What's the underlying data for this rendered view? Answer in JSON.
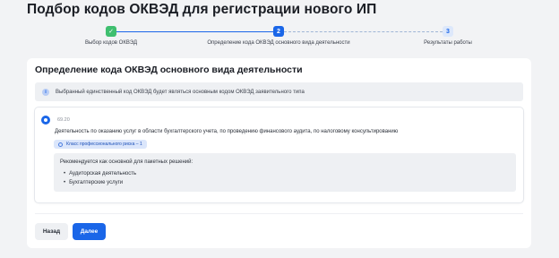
{
  "page": {
    "title": "Подбор кодов ОКВЭД для регистрации нового ИП"
  },
  "stepper": {
    "steps": [
      {
        "number": "✓",
        "label": "Выбор кодов ОКВЭД",
        "state": "done"
      },
      {
        "number": "2",
        "label": "Определение кода ОКВЭД основного вида деятельности",
        "state": "active"
      },
      {
        "number": "3",
        "label": "Результаты работы",
        "state": "todo"
      }
    ]
  },
  "card": {
    "title": "Определение кода ОКВЭД основного вида деятельности",
    "info": {
      "icon": "info-icon",
      "text": "Выбранный единственный код ОКВЭД будет являться основным кодом ОКВЭД заявительного типа"
    },
    "option": {
      "selected": true,
      "code": "69.20",
      "description": "Деятельность по оказанию услуг в области бухгалтерского учета, по проведению финансового аудита, по налоговому консультированию",
      "risk_badge": "Класс профессионального риска – 1",
      "recommendation": {
        "title": "Рекомендуется как основной для пакетных решений:",
        "items": [
          "Аудиторская деятельность",
          "Бухгалтерские услуги"
        ]
      }
    }
  },
  "buttons": {
    "back": "Назад",
    "next": "Далее"
  },
  "colors": {
    "accent": "#1a66e8",
    "success": "#3fbf6f",
    "background": "#f2f3f5"
  }
}
